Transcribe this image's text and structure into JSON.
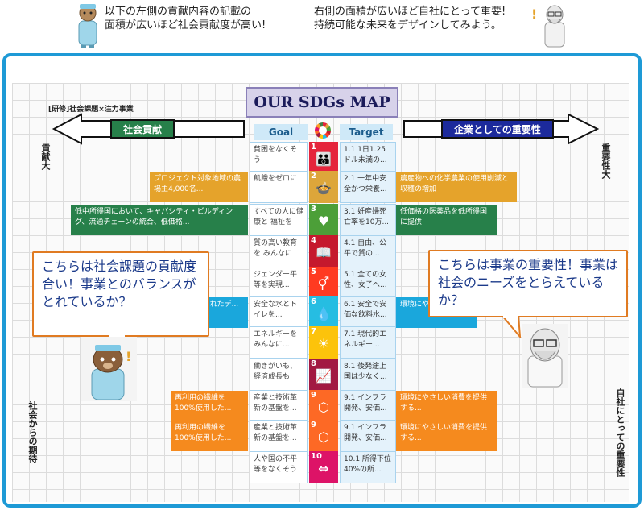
{
  "header": {
    "left_text_1": "以下の左側の貢献内容の記載の",
    "left_text_2": "面積が広いほど社会貢献度が高い!",
    "right_text_1": "右側の面積が広いほど自社にとって重要!",
    "right_text_2": "持続可能な未来をデザインしてみよう。"
  },
  "map": {
    "title": "OUR SDGs MAP",
    "subtitle": "[研修]社会課題×注力事業",
    "left_arrow_label": "社会貢献",
    "right_arrow_label": "企業としての重要性",
    "goal_header": "Goal",
    "target_header": "Target",
    "left_top_label": "貢献大",
    "right_top_label": "重要性大",
    "left_bottom_label": "社会からの期待",
    "right_bottom_label": "自社にとっての重要性"
  },
  "rows": [
    {
      "goal": "貧困をなくそう",
      "num": "1",
      "color": "#e5243b",
      "icon": "👪",
      "target": "1.1 1日1.25ドル未満の..."
    },
    {
      "goal": "飢餓をゼロに",
      "num": "2",
      "color": "#dda63a",
      "icon": "🍲",
      "target": "2.1 一年中安全かつ栄養..."
    },
    {
      "goal": "すべての人に健康と 福祉を",
      "num": "3",
      "color": "#4c9f38",
      "icon": "♥",
      "target": "3.1 妊産婦死亡率を10万..."
    },
    {
      "goal": "質の高い教育を みんなに",
      "num": "4",
      "color": "#c5192d",
      "icon": "📖",
      "target": "4.1 自由、公平で質の..."
    },
    {
      "goal": "ジェンダー平等を実現...",
      "num": "5",
      "color": "#ff3a21",
      "icon": "⚥",
      "target": "5.1 全ての女性、女子へ..."
    },
    {
      "goal": "安全な水とトイレを...",
      "num": "6",
      "color": "#26bde2",
      "icon": "💧",
      "target": "6.1 安全で安価な飲料水..."
    },
    {
      "goal": "エネルギーを みんなに...",
      "num": "7",
      "color": "#fcc30b",
      "icon": "☀",
      "target": "7.1 現代的エネルギー..."
    },
    {
      "goal": "働きがいも、経済成長も",
      "num": "8",
      "color": "#a21942",
      "icon": "📈",
      "target": "8.1 後発途上国は少なく..."
    },
    {
      "goal": "産業と技術革新の基盤を...",
      "num": "9",
      "color": "#fd6925",
      "icon": "⬡",
      "target": "9.1 インフラ開発、安価..."
    },
    {
      "goal": "産業と技術革新の基盤を...",
      "num": "9",
      "color": "#fd6925",
      "icon": "⬡",
      "target": "9.1 インフラ開発、安価..."
    },
    {
      "goal": "人や国の不平等をなくそう",
      "num": "10",
      "color": "#dd1367",
      "icon": "⇔",
      "target": "10.1 所得下位40%の所..."
    }
  ],
  "bars": {
    "row2_left": "プロジェクト対象地域の農場主4,000名...",
    "row2_right": "農産物への化学農業の使用削減と収穫の増加",
    "row3_left": "低中所得国において、キャパシティ・ビルディング、流通チェーンの統合、低価格...",
    "row3_right": "低価格の医薬品を低所得国に提供",
    "row6_left": "...されたデ...",
    "row6_right": "環境にや...を提供...",
    "row9_left": "再利用の繊維を100%使用した...",
    "row9_right": "環境にやさしい消費を提供する...",
    "row10_left": "再利用の繊維を100%使用した...",
    "row10_right": "環境にやさしい消費を提供する..."
  },
  "bubbles": {
    "left": "こちらは社会課題の貢献度合い！事業とのバランスがとれているか？",
    "right": "こちらは事業の重要性！事業は社会のニーズをとらえているか？"
  },
  "colors": {
    "frame": "#1e9ad6",
    "green": "#27804a",
    "gold": "#e5a32b",
    "orange": "#f58a1e",
    "cyan": "#1aa7dc",
    "navy": "#1c2a9c"
  }
}
